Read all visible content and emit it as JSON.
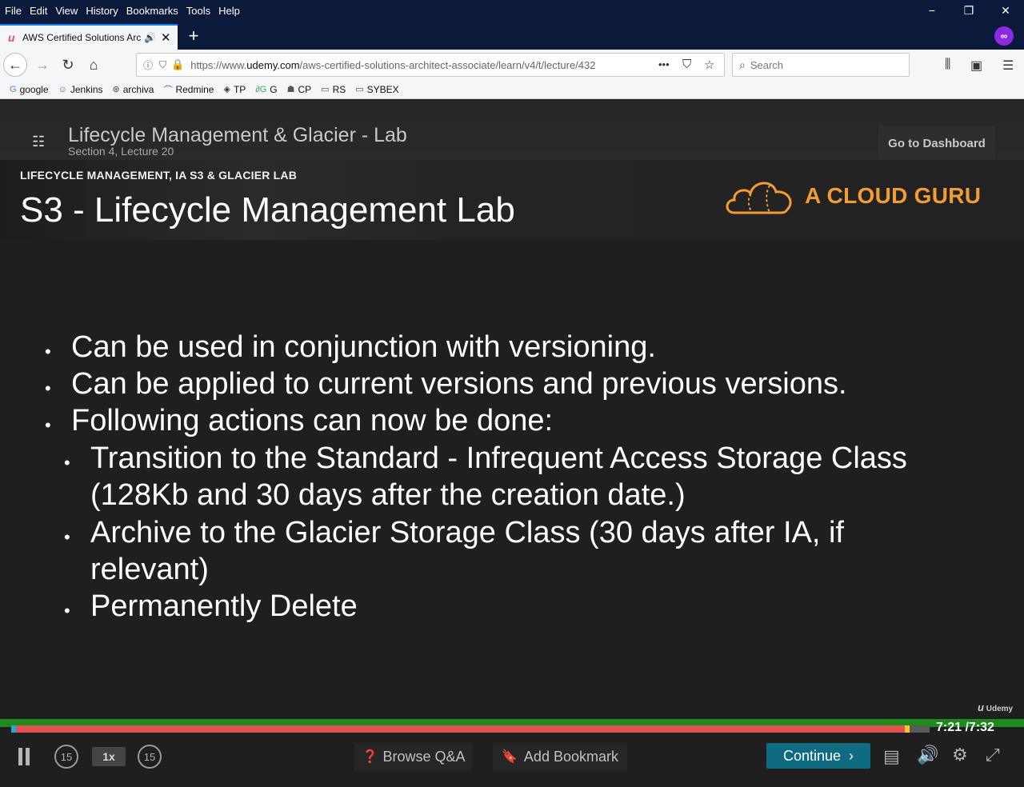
{
  "browser": {
    "menu": [
      "File",
      "Edit",
      "View",
      "History",
      "Bookmarks",
      "Tools",
      "Help"
    ],
    "menu_underline": [
      "F",
      "E",
      "V",
      "s",
      "B",
      "T",
      "H"
    ],
    "window_controls": {
      "minimize": "−",
      "restore": "❐",
      "close": "✕"
    },
    "tab": {
      "title": "AWS Certified Solutions Arc",
      "favicon": "u",
      "speaker": "🔊",
      "close": "✕"
    },
    "new_tab": "+",
    "url": {
      "prefix": "https://www.",
      "domain": "udemy.com",
      "path": "/aws-certified-solutions-architect-associate/learn/v4/t/lecture/432"
    },
    "page_actions": "•••",
    "search_placeholder": "Search",
    "bookmarks": [
      {
        "label": "google",
        "icon": "G",
        "icon_color": "#4285f4"
      },
      {
        "label": "Jenkins",
        "icon": "☺",
        "icon_color": "#c0392b"
      },
      {
        "label": "archiva",
        "icon": "⊛",
        "icon_color": "#444444"
      },
      {
        "label": "Redmine",
        "icon": "⌒",
        "icon_color": "#b22222"
      },
      {
        "label": "TP",
        "icon": "◈",
        "icon_color": "#333333"
      },
      {
        "label": "G",
        "icon": "∂G",
        "icon_color": "#3aa655"
      },
      {
        "label": "CP",
        "icon": "☗",
        "icon_color": "#555555"
      },
      {
        "label": "RS",
        "icon": "▭",
        "icon_color": "#444444"
      },
      {
        "label": "SYBEX",
        "icon": "▭",
        "icon_color": "#444444"
      }
    ]
  },
  "course": {
    "lecture_title": "Lifecycle Management & Glacier - Lab",
    "lecture_subtitle": "Section 4, Lecture 20",
    "dashboard_button": "Go to Dashboard"
  },
  "slide": {
    "topic": "LIFECYCLE MANAGEMENT, IA S3 & GLACIER LAB",
    "title": "S3 - Lifecycle Management Lab",
    "brand": "A CLOUD GURU",
    "bullets": [
      "Can be used in conjunction with versioning.",
      "Can be applied to current versions and previous versions.",
      "Following actions can now be done:"
    ],
    "sub_bullets": [
      {
        "line1": "Transition to the Standard - Infrequent Access Storage Class",
        "line2": "(128Kb and 30 days after the creation date.)"
      },
      {
        "line1": "Archive to the Glacier Storage Class (30 days after IA, if",
        "line2": "relevant)"
      },
      {
        "line1": "Permanently Delete",
        "line2": ""
      }
    ],
    "watermark": "Udemy"
  },
  "player": {
    "time_current": "7:21",
    "time_total": "/7:32",
    "progress_fraction": 0.976,
    "rewind_label": "15",
    "forward_label": "15",
    "speed": "1x",
    "browse_qa": "Browse Q&A",
    "add_bookmark": "Add Bookmark",
    "continue": "Continue",
    "colors": {
      "accent": "#0f6b82",
      "progress": "#e0524e",
      "brand": "#f39c34"
    }
  }
}
